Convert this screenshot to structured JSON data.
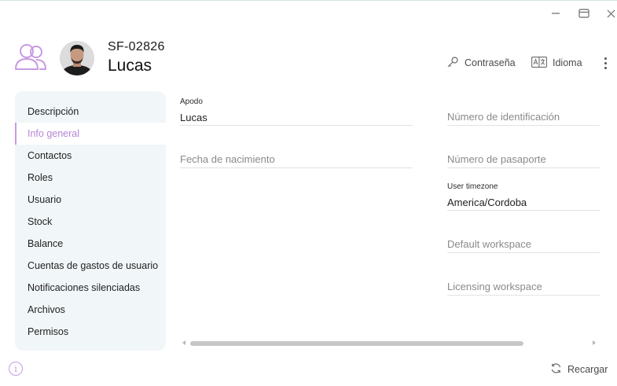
{
  "window": {
    "minimize_icon": "minimize-icon",
    "maximize_icon": "maximize-icon",
    "close_icon": "close-icon"
  },
  "header": {
    "users_icon": "users-icon",
    "code": "SF-02826",
    "name": "Lucas",
    "actions": {
      "password_label": "Contraseña",
      "password_icon": "key-icon",
      "language_label": "Idioma",
      "language_icon": "translate-icon",
      "more_icon": "more-vertical-icon"
    }
  },
  "sidebar": {
    "items": [
      {
        "label": "Descripción"
      },
      {
        "label": "Info general",
        "active": true
      },
      {
        "label": "Contactos"
      },
      {
        "label": "Roles"
      },
      {
        "label": "Usuario"
      },
      {
        "label": "Stock"
      },
      {
        "label": "Balance"
      },
      {
        "label": "Cuentas de gastos de usuario"
      },
      {
        "label": "Notificaciones silenciadas"
      },
      {
        "label": "Archivos"
      },
      {
        "label": "Permisos"
      }
    ]
  },
  "form": {
    "apodo": {
      "label": "Apodo",
      "value": "Lucas"
    },
    "fecha_nacimiento": {
      "placeholder": "Fecha de nacimiento"
    },
    "numero_identificacion": {
      "placeholder": "Número de identificación"
    },
    "numero_pasaporte": {
      "placeholder": "Número de pasaporte"
    },
    "user_timezone": {
      "label": "User timezone",
      "value": "America/Cordoba"
    },
    "default_workspace": {
      "placeholder": "Default workspace"
    },
    "licensing_workspace": {
      "placeholder": "Licensing workspace"
    }
  },
  "footer": {
    "info_icon": "info-icon",
    "info_glyph": "i",
    "reload_label": "Recargar",
    "reload_icon": "refresh-icon"
  },
  "colors": {
    "accent": "#c99ae4",
    "sidebar_bg": "#f1f6f8",
    "active_text": "#b784d6"
  }
}
